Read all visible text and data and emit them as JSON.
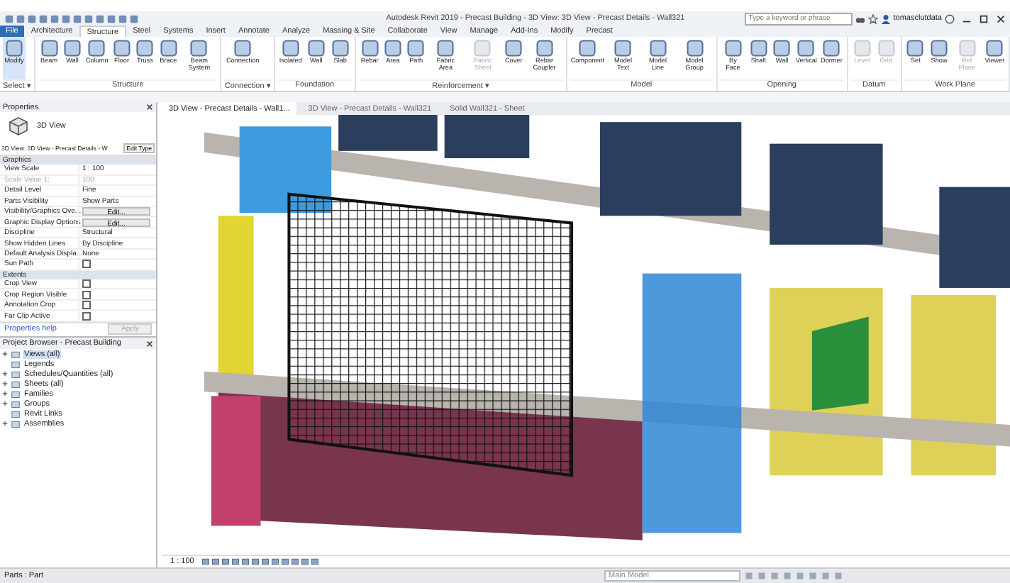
{
  "window": {
    "title": "Autodesk Revit 2019 - Precast Building - 3D View: 3D View - Precast Details - Wall321",
    "search": {
      "placeholder": "Type a keyword or phrase"
    },
    "user": "tomasclutdata"
  },
  "ribbon_tabs": [
    {
      "label": "File",
      "kind": "file",
      "selected": false
    },
    {
      "label": "Architecture",
      "kind": "tab",
      "selected": false
    },
    {
      "label": "Structure",
      "kind": "tab",
      "selected": true
    },
    {
      "label": "Steel",
      "kind": "tab",
      "selected": false
    },
    {
      "label": "Systems",
      "kind": "tab",
      "selected": false
    },
    {
      "label": "Insert",
      "kind": "tab",
      "selected": false
    },
    {
      "label": "Annotate",
      "kind": "tab",
      "selected": false
    },
    {
      "label": "Analyze",
      "kind": "tab",
      "selected": false
    },
    {
      "label": "Massing & Site",
      "kind": "tab",
      "selected": false
    },
    {
      "label": "Collaborate",
      "kind": "tab",
      "selected": false
    },
    {
      "label": "View",
      "kind": "tab",
      "selected": false
    },
    {
      "label": "Manage",
      "kind": "tab",
      "selected": false
    },
    {
      "label": "Add-Ins",
      "kind": "tab",
      "selected": false
    },
    {
      "label": "Modify",
      "kind": "tab",
      "selected": false
    },
    {
      "label": "Precast",
      "kind": "tab",
      "selected": false
    }
  ],
  "ribbon_panels": [
    {
      "label": "Select ▾",
      "tools": [
        {
          "label": "Modify",
          "disabled": false,
          "selected": true
        }
      ]
    },
    {
      "label": "Structure",
      "tools": [
        {
          "label": "Beam",
          "disabled": false,
          "selected": false
        },
        {
          "label": "Wall",
          "disabled": false,
          "selected": false
        },
        {
          "label": "Column",
          "disabled": false,
          "selected": false
        },
        {
          "label": "Floor",
          "disabled": false,
          "selected": false
        },
        {
          "label": "Truss",
          "disabled": false,
          "selected": false
        },
        {
          "label": "Brace",
          "disabled": false,
          "selected": false
        },
        {
          "label": "Beam System",
          "disabled": false,
          "selected": false
        }
      ]
    },
    {
      "label": "Connection ▾",
      "tools": [
        {
          "label": "Connection",
          "disabled": false,
          "selected": false
        }
      ]
    },
    {
      "label": "Foundation",
      "tools": [
        {
          "label": "Isolated",
          "disabled": false,
          "selected": false
        },
        {
          "label": "Wall",
          "disabled": false,
          "selected": false
        },
        {
          "label": "Slab",
          "disabled": false,
          "selected": false
        }
      ]
    },
    {
      "label": "Reinforcement ▾",
      "tools": [
        {
          "label": "Rebar",
          "disabled": false,
          "selected": false
        },
        {
          "label": "Area",
          "disabled": false,
          "selected": false
        },
        {
          "label": "Path",
          "disabled": false,
          "selected": false
        },
        {
          "label": "Fabric Area",
          "disabled": false,
          "selected": false
        },
        {
          "label": "Fabric Sheet",
          "disabled": true,
          "selected": false
        },
        {
          "label": "Cover",
          "disabled": false,
          "selected": false
        },
        {
          "label": "Rebar Coupler",
          "disabled": false,
          "selected": false
        }
      ]
    },
    {
      "label": "Model",
      "tools": [
        {
          "label": "Component",
          "disabled": false,
          "selected": false
        },
        {
          "label": "Model Text",
          "disabled": false,
          "selected": false
        },
        {
          "label": "Model Line",
          "disabled": false,
          "selected": false
        },
        {
          "label": "Model Group",
          "disabled": false,
          "selected": false
        }
      ]
    },
    {
      "label": "Opening",
      "tools": [
        {
          "label": "By Face",
          "disabled": false,
          "selected": false
        },
        {
          "label": "Shaft",
          "disabled": false,
          "selected": false
        },
        {
          "label": "Wall",
          "disabled": false,
          "selected": false
        },
        {
          "label": "Vertical",
          "disabled": false,
          "selected": false
        },
        {
          "label": "Dormer",
          "disabled": false,
          "selected": false
        }
      ]
    },
    {
      "label": "Datum",
      "tools": [
        {
          "label": "Level",
          "disabled": true,
          "selected": false
        },
        {
          "label": "Grid",
          "disabled": true,
          "selected": false
        }
      ]
    },
    {
      "label": "Work Plane",
      "tools": [
        {
          "label": "Set",
          "disabled": false,
          "selected": false
        },
        {
          "label": "Show",
          "disabled": false,
          "selected": false
        },
        {
          "label": "Ref Plane",
          "disabled": true,
          "selected": false
        },
        {
          "label": "Viewer",
          "disabled": false,
          "selected": false
        }
      ]
    }
  ],
  "properties": {
    "title": "Properties",
    "type": "3D View",
    "selector": "3D View: 3D View - Precast Details - W",
    "edit_type": "Edit Type",
    "groups": [
      {
        "label": "Graphics",
        "rows": [
          {
            "name": "View Scale",
            "kind": "text",
            "value": "1 : 100",
            "disabled": false
          },
          {
            "name": "Scale Value    1:",
            "kind": "text",
            "value": "100",
            "disabled": true
          },
          {
            "name": "Detail Level",
            "kind": "text",
            "value": "Fine",
            "disabled": false
          },
          {
            "name": "Parts Visibility",
            "kind": "text",
            "value": "Show Parts",
            "disabled": false
          },
          {
            "name": "Visibility/Graphics Ove...",
            "kind": "button",
            "value": "Edit...",
            "disabled": false
          },
          {
            "name": "Graphic Display Options",
            "kind": "button",
            "value": "Edit...",
            "disabled": false
          },
          {
            "name": "Discipline",
            "kind": "text",
            "value": "Structural",
            "disabled": false
          },
          {
            "name": "Show Hidden Lines",
            "kind": "text",
            "value": "By Discipline",
            "disabled": false
          },
          {
            "name": "Default Analysis Displa...",
            "kind": "text",
            "value": "None",
            "disabled": false
          },
          {
            "name": "Sun Path",
            "kind": "checkbox",
            "checked": false,
            "disabled": false
          }
        ]
      },
      {
        "label": "Extents",
        "rows": [
          {
            "name": "Crop View",
            "kind": "checkbox",
            "checked": false,
            "disabled": false
          },
          {
            "name": "Crop Region Visible",
            "kind": "checkbox",
            "checked": false,
            "disabled": false
          },
          {
            "name": "Annotation Crop",
            "kind": "checkbox",
            "checked": false,
            "disabled": false
          },
          {
            "name": "Far Clip Active",
            "kind": "checkbox",
            "checked": false,
            "disabled": false
          }
        ]
      }
    ],
    "help_link": "Properties help",
    "apply": {
      "label": "Apply",
      "disabled": true
    }
  },
  "project_browser": {
    "title": "Project Browser - Precast Building",
    "items": [
      {
        "label": "Views (all)",
        "has_children": true,
        "selected": true
      },
      {
        "label": "Legends",
        "has_children": false,
        "selected": false
      },
      {
        "label": "Schedules/Quantities (all)",
        "has_children": true,
        "selected": false
      },
      {
        "label": "Sheets (all)",
        "has_children": true,
        "selected": false
      },
      {
        "label": "Families",
        "has_children": true,
        "selected": false
      },
      {
        "label": "Groups",
        "has_children": true,
        "selected": false
      },
      {
        "label": "Revit Links",
        "has_children": false,
        "selected": false
      },
      {
        "label": "Assemblies",
        "has_children": true,
        "selected": false
      }
    ]
  },
  "view_tabs": [
    {
      "label": "3D View - Precast Details - Wall1...",
      "selected": true
    },
    {
      "label": "3D View - Precast Details - Wall321",
      "selected": false
    },
    {
      "label": "Solid Wall321 - Sheet",
      "selected": false
    }
  ],
  "view_control": {
    "scale": "1 : 100"
  },
  "status_bar": {
    "message": "Parts : Part",
    "model": "Main Model"
  }
}
